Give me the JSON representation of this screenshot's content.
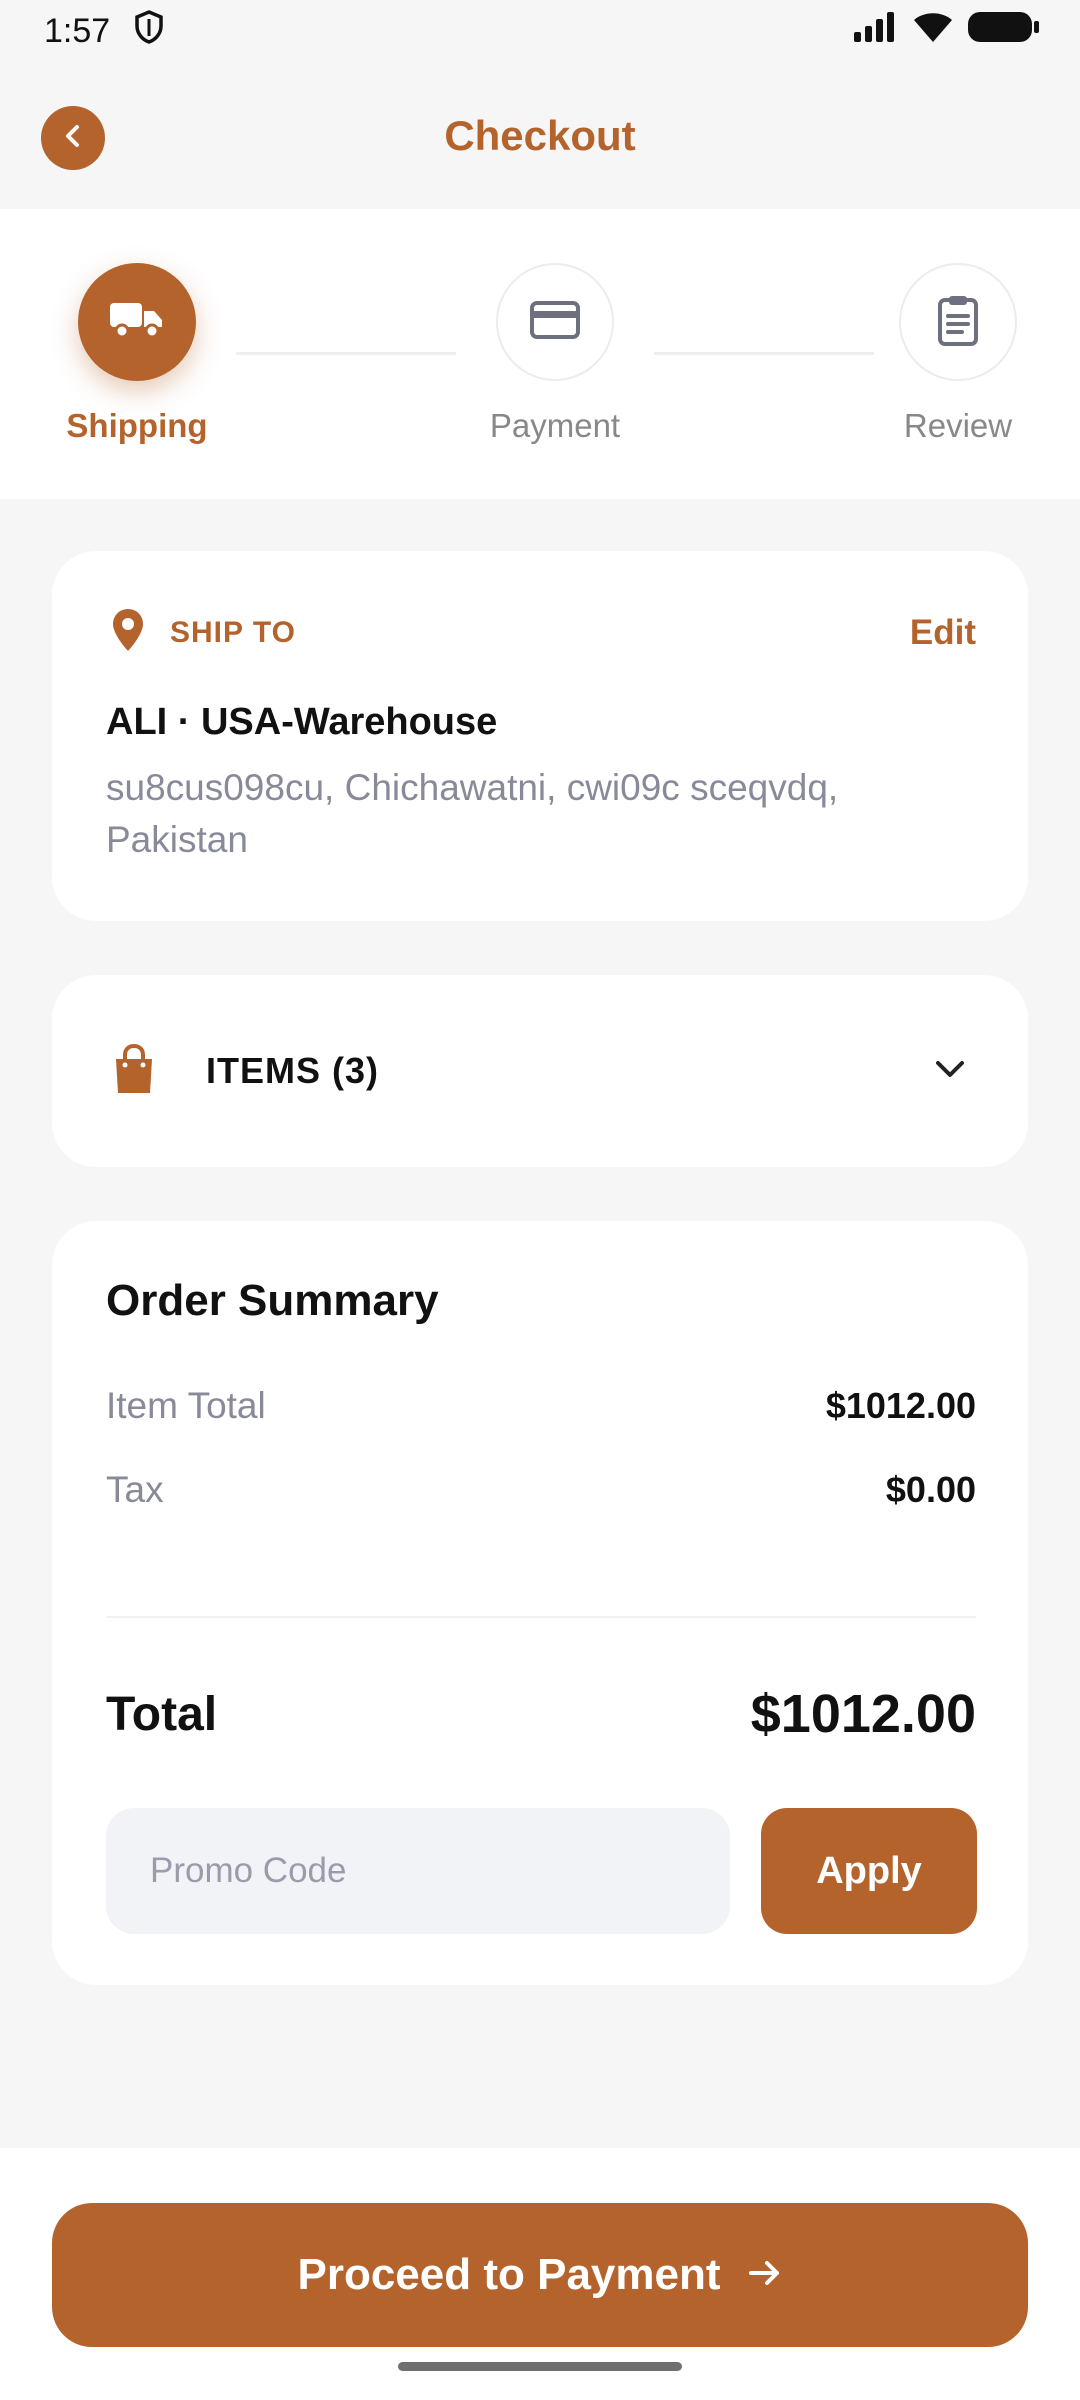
{
  "status_bar": {
    "time": "1:57"
  },
  "header": {
    "title": "Checkout"
  },
  "stepper": {
    "steps": [
      {
        "label": "Shipping",
        "icon": "truck-icon",
        "active": true
      },
      {
        "label": "Payment",
        "icon": "credit-card-icon",
        "active": false
      },
      {
        "label": "Review",
        "icon": "clipboard-icon",
        "active": false
      }
    ]
  },
  "ship_to": {
    "label": "SHIP TO",
    "edit_label": "Edit",
    "name": "ALI · USA-Warehouse",
    "address": "su8cus098cu, Chichawatni, cwi09c sceqvdq, Pakistan"
  },
  "items": {
    "label": "ITEMS (3)"
  },
  "summary": {
    "title": "Order Summary",
    "item_total_label": "Item Total",
    "item_total_value": "$1012.00",
    "tax_label": "Tax",
    "tax_value": "$0.00",
    "total_label": "Total",
    "total_value": "$1012.00",
    "promo_placeholder": "Promo Code",
    "apply_label": "Apply"
  },
  "footer": {
    "proceed_label": "Proceed to Payment"
  },
  "colors": {
    "accent": "#b5632d",
    "muted": "#888a99",
    "background": "#f6f6f6"
  }
}
